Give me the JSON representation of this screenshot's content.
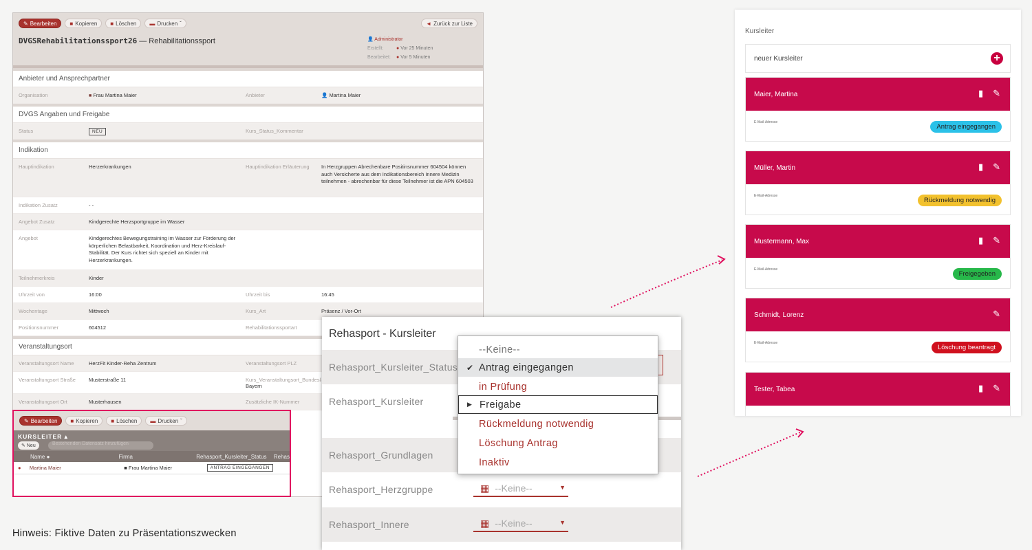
{
  "record": {
    "toolbar": {
      "edit": "Bearbeiten",
      "copy": "Kopieren",
      "delete": "Löschen",
      "print": "Drucken",
      "back": "Zurück zur Liste"
    },
    "title_code": "DVGSRehabilitationssport26",
    "title_name": "— Rehabilitationssport",
    "meta": {
      "owner": "Administrator",
      "created_label": "Erstellt:",
      "created": "Vor 25 Minuten",
      "edited_label": "Bearbeitet:",
      "edited": "Vor 5 Minuten"
    },
    "sections": {
      "provider": "Anbieter und Ansprechpartner",
      "dvgs": "DVGS Angaben und Freigabe",
      "indication": "Indikation",
      "venue": "Veranstaltungsort"
    },
    "fields": {
      "org_label": "Organisation",
      "org_value": "Frau Martina Maier",
      "provider_label": "Anbieter",
      "provider_value": "Martina Maier",
      "status_label": "Status",
      "status_value": "NEU",
      "status_comment_label": "Kurs_Status_Kommentar",
      "main_ind_label": "Hauptindikation",
      "main_ind_value": "Herzerkrankungen",
      "main_ind_expl_label": "Hauptindikation Erläuterung",
      "main_ind_expl_value": "In Herzgruppen Abrechenbare Positinsnummer 604504 können auch Versicherte aus dem Indikationsbereich Innere Medizin teilnehmen - abrechenbar für diese Teilnehmer ist die APN 604503",
      "ind_extra_label": "Indikation Zusatz",
      "ind_extra_value": "- -",
      "offer_extra_label": "Angebot Zusatz",
      "offer_extra_value": "Kindgerechte Herzsportgruppe im Wasser",
      "offer_label": "Angebot",
      "offer_value": "Kindgerechtes Bewegungstraining im Wasser zur Förderung der körperlichen Belastbarkeit, Koordination und Herz-Kreislauf-Stabilität. Der Kurs richtet sich speziell an Kinder mit Herzerkrankungen.",
      "participants_label": "Teilnehmerkreis",
      "participants_value": "Kinder",
      "time_from_label": "Uhrzeit von",
      "time_from_value": "16:00",
      "time_to_label": "Uhrzeit bis",
      "time_to_value": "16:45",
      "weekday_label": "Wochentage",
      "weekday_value": "Mittwoch",
      "course_type_label": "Kurs_Art",
      "course_type_value": "Präsenz / Vor-Ort",
      "position_label": "Positionsnummer",
      "position_value": "604512",
      "rehab_type_label": "Rehabilitationssportart",
      "venue_name_label": "Veranstaltungsort Name",
      "venue_name_value": "HerzFit Kinder-Reha Zentrum",
      "venue_zip_label": "Veranstaltungsort PLZ",
      "venue_street_label": "Veranstaltungsort Straße",
      "venue_street_value": "Musterstraße 11",
      "venue_state_label": "Kurs_Veranstaltungsort_Bundesland",
      "venue_state_value": "Bayern",
      "venue_city_label": "Veranstaltungsort Ort",
      "venue_city_value": "Musterhausen",
      "ik_label": "Zusätzliche IK-Nummer"
    }
  },
  "kursleiter_panel": {
    "toolbar": {
      "edit": "Bearbeiten",
      "copy": "Kopieren",
      "delete": "Löschen",
      "print": "Drucken"
    },
    "title": "KURSLEITER ▴",
    "new": "Neu",
    "ghost": "Bestehenden Datensatz hinzufügen",
    "columns": {
      "name": "Name",
      "company": "Firma",
      "status": "Rehasport_Kursleiter_Status",
      "more": "Rehas"
    },
    "row": {
      "name": "Martina Maier",
      "company": "Frau Martina Maier",
      "status": "ANTRAG EINGEGANGEN"
    }
  },
  "zoom": {
    "title": "Rehasport - Kursleiter",
    "labels": {
      "status": "Rehasport_Kursleiter_Status",
      "leader": "Rehasport_Kursleiter",
      "basics": "Rehasport_Grundlagen",
      "heart": "Rehasport_Herzgruppe",
      "inner": "Rehasport_Innere"
    },
    "select_placeholder": "--Keine--"
  },
  "dropdown": {
    "options": [
      "--Keine--",
      "Antrag eingegangen",
      "in Prüfung",
      "Freigabe",
      "Rückmeldung notwendig",
      "Löschung Antrag",
      "Inaktiv"
    ]
  },
  "cards": {
    "title": "Kursleiter",
    "new_label": "neuer Kursleiter",
    "mail_label": "E-Mail-Adresse",
    "items": [
      {
        "name": "Maier, Martina",
        "status": "Antrag eingegangen"
      },
      {
        "name": "Müller, Martin",
        "status": "Rückmeldung notwendig"
      },
      {
        "name": "Mustermann, Max",
        "status": "Freigegeben"
      },
      {
        "name": "Schmidt, Lorenz",
        "status": "Löschung beantragt"
      },
      {
        "name": "Tester, Tabea",
        "status": ""
      }
    ],
    "colors": {
      "header": "#c70a4b",
      "received": "#2bc1e8",
      "feedback": "#f2c12e",
      "approved": "#27b84a",
      "deletion": "#d0101e"
    }
  },
  "note": "Hinweis: Fiktive Daten zu Präsentationszwecken"
}
